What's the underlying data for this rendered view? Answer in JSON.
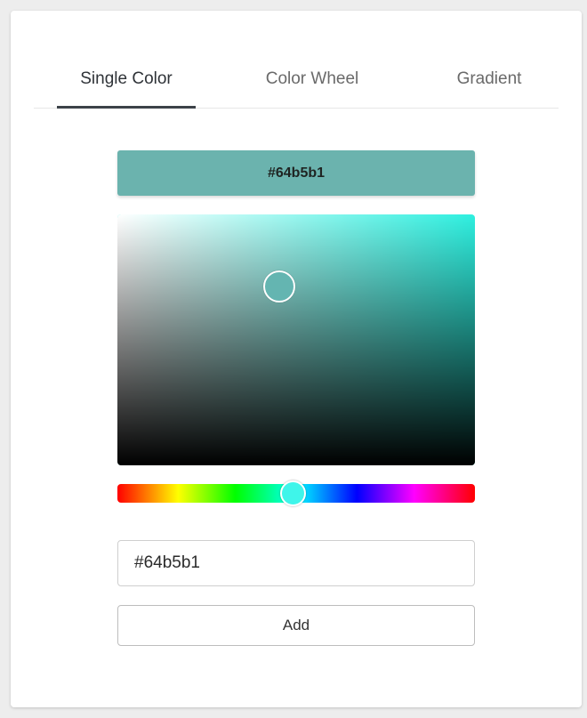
{
  "tabs": [
    {
      "label": "Single Color",
      "active": true
    },
    {
      "label": "Color Wheel",
      "active": false
    },
    {
      "label": "Gradient",
      "active": false
    }
  ],
  "swatch": {
    "label": "#64b5b1",
    "color": "#6bb3ae"
  },
  "picker": {
    "hue_color": "#2ef0e0",
    "hue_degrees": 176,
    "saturation": 0.45,
    "value": 0.71,
    "handle_color": "#64b5b1",
    "hue_handle_color": "#3ff5ea"
  },
  "hex_input": {
    "value": "#64b5b1"
  },
  "add_button": {
    "label": "Add"
  }
}
